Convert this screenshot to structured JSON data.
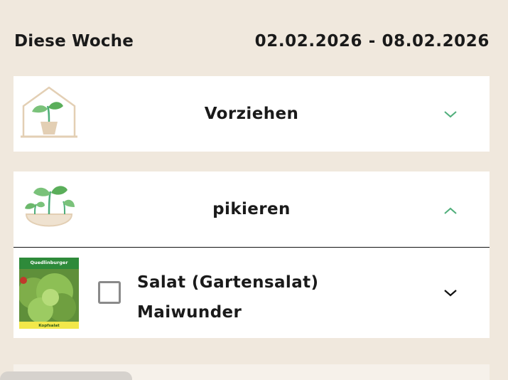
{
  "week": {
    "label": "Diese Woche",
    "range": "02.02.2026 - 08.02.2026"
  },
  "sections": [
    {
      "title": "Vorziehen",
      "icon": "greenhouse-seedling-icon",
      "expanded": false
    },
    {
      "title": "pikieren",
      "icon": "seedlings-bowl-icon",
      "expanded": true
    }
  ],
  "plants": [
    {
      "line1": "Salat (Gartensalat)",
      "line2": "Maiwunder",
      "checked": false,
      "pack_brand": "Quedlinburger",
      "pack_label": "Kopfsalat"
    }
  ],
  "colors": {
    "background": "#f0e8dd",
    "card": "#ffffff",
    "accent_green": "#4fae7a",
    "text": "#1a1a1a"
  }
}
